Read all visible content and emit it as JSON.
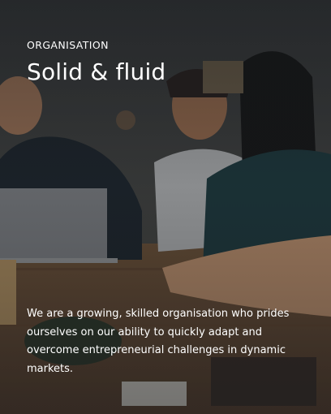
{
  "section": {
    "eyebrow": "ORGANISATION",
    "title": "Solid & fluid",
    "description": "We are a growing, skilled organisation who prides ourselves on our ability to quickly adapt and overcome entrepreneurial challenges in dynamic markets."
  },
  "background": {
    "image": "team-meeting-photo"
  }
}
